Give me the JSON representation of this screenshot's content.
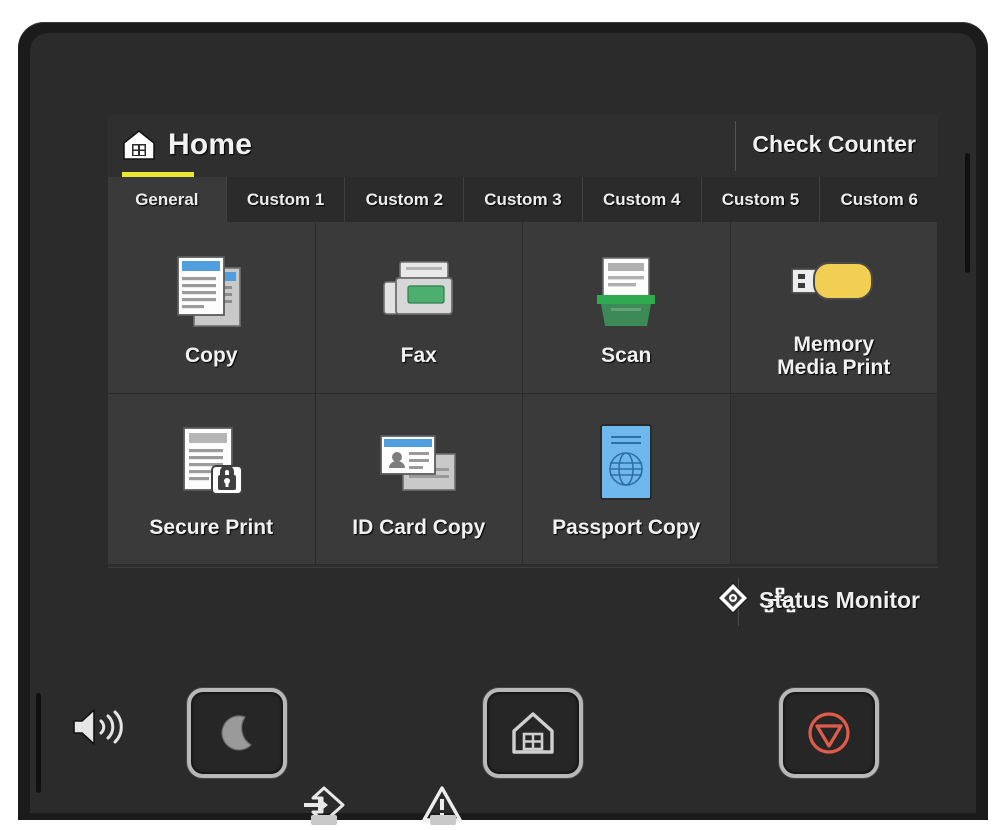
{
  "device": {
    "panel_name": "printer-control-panel",
    "colors": {
      "screen_bg": "#2f2f2f",
      "tile_bg": "#3a3a3a",
      "accent_yellow": "#e8e832",
      "stop_red": "#e05b4a",
      "fax_green": "#4caf6e",
      "copy_blue": "#4f9fe0",
      "usb_yellow": "#f2cf52",
      "passport_blue": "#6fb8ee"
    }
  },
  "screen": {
    "header": {
      "home_label": "Home",
      "home_icon": "home-icon",
      "check_counter_label": "Check Counter"
    },
    "tabs": [
      {
        "label": "General",
        "active": true
      },
      {
        "label": "Custom 1",
        "active": false
      },
      {
        "label": "Custom 2",
        "active": false
      },
      {
        "label": "Custom 3",
        "active": false
      },
      {
        "label": "Custom 4",
        "active": false
      },
      {
        "label": "Custom 5",
        "active": false
      },
      {
        "label": "Custom 6",
        "active": false
      }
    ],
    "tiles": [
      {
        "label": "Copy",
        "icon": "copy-documents-icon",
        "empty": false
      },
      {
        "label": "Fax",
        "icon": "fax-machine-icon",
        "empty": false
      },
      {
        "label": "Scan",
        "icon": "scanner-icon",
        "empty": false
      },
      {
        "label": "Memory\nMedia Print",
        "icon": "usb-drive-icon",
        "empty": false
      },
      {
        "label": "Secure Print",
        "icon": "document-lock-icon",
        "empty": false
      },
      {
        "label": "ID Card Copy",
        "icon": "id-card-icon",
        "empty": false
      },
      {
        "label": "Passport Copy",
        "icon": "passport-book-icon",
        "empty": false
      },
      {
        "label": "",
        "icon": "",
        "empty": true
      }
    ],
    "tile_labels": {
      "copy": "Copy",
      "fax": "Fax",
      "scan": "Scan",
      "memory_media_print_line1": "Memory",
      "memory_media_print_line2": "Media Print",
      "secure_print": "Secure Print",
      "id_card_copy": "ID Card Copy",
      "passport_copy": "Passport Copy"
    },
    "status_bar": {
      "network_icon": "network-lan-icon",
      "status_monitor_icon": "status-monitor-diamond-icon",
      "status_monitor_label": "Status Monitor"
    }
  },
  "hardware": {
    "speaker_icon": "speaker-volume-icon",
    "buttons": [
      {
        "name": "sleep-button",
        "icon": "crescent-moon-icon"
      },
      {
        "name": "home-button",
        "icon": "home-icon"
      },
      {
        "name": "stop-button",
        "icon": "stop-circle-icon"
      }
    ],
    "indicators": [
      {
        "name": "data-indicator",
        "icon": "data-arrow-diamond-icon"
      },
      {
        "name": "error-indicator",
        "icon": "warning-triangle-icon"
      }
    ]
  }
}
